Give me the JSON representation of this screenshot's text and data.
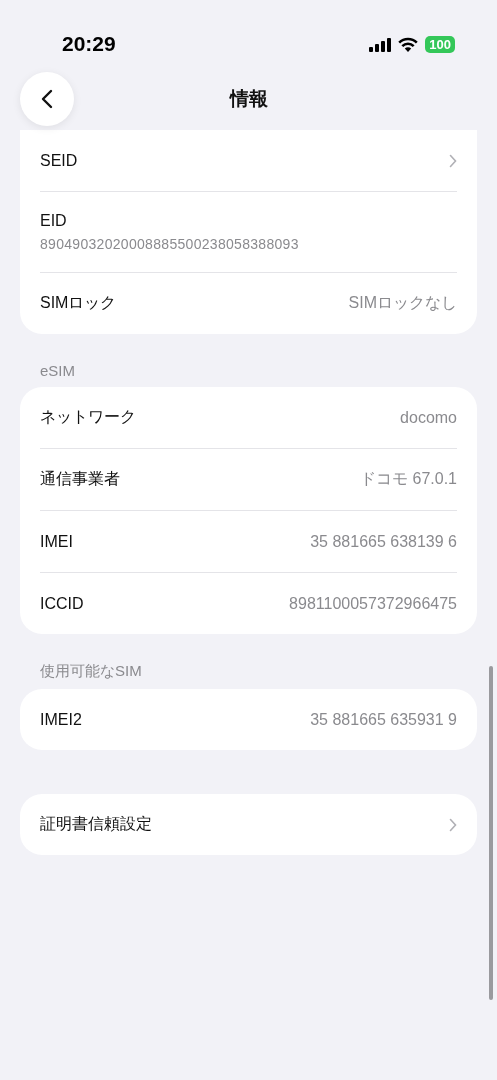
{
  "status_bar": {
    "time": "20:29",
    "battery": "100"
  },
  "nav": {
    "title": "情報"
  },
  "sections": [
    {
      "rows": [
        {
          "kind": "link",
          "label": "SEID"
        },
        {
          "kind": "stacked",
          "label": "EID",
          "value": "89049032020008885500238058388093"
        },
        {
          "kind": "value",
          "label": "SIMロック",
          "value": "SIMロックなし"
        }
      ]
    },
    {
      "header": "eSIM",
      "rows": [
        {
          "kind": "value",
          "label": "ネットワーク",
          "value": "docomo"
        },
        {
          "kind": "value",
          "label": "通信事業者",
          "value": "ドコモ 67.0.1"
        },
        {
          "kind": "value",
          "label": "IMEI",
          "value": "35 881665 638139 6"
        },
        {
          "kind": "value",
          "label": "ICCID",
          "value": "8981100057372966475"
        }
      ]
    },
    {
      "header": "使用可能なSIM",
      "rows": [
        {
          "kind": "value",
          "label": "IMEI2",
          "value": "35 881665 635931 9"
        }
      ]
    },
    {
      "rows": [
        {
          "kind": "link",
          "label": "証明書信頼設定"
        }
      ]
    }
  ]
}
